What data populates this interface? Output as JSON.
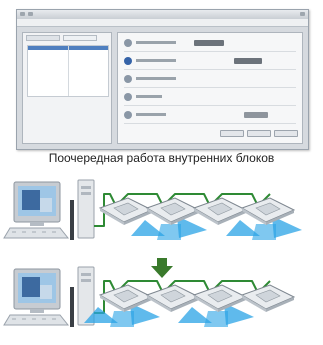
{
  "caption": "Поочередная работа внутренних блоков",
  "colors": {
    "wire": "#2e8a34",
    "arrow": "#3a7a2c",
    "airflow": "#29a3e6",
    "monitor_frame": "#c7ccd2",
    "unit_body": "#e9ecef"
  },
  "icons": {
    "computer": "computer-icon",
    "indoor_unit": "cassette-ac-unit-icon",
    "arrow": "arrow-down-icon"
  },
  "rows": [
    {
      "name": "state-before",
      "active_units": [
        false,
        true,
        false,
        true
      ]
    },
    {
      "name": "state-after",
      "active_units": [
        true,
        false,
        true,
        false
      ]
    }
  ]
}
